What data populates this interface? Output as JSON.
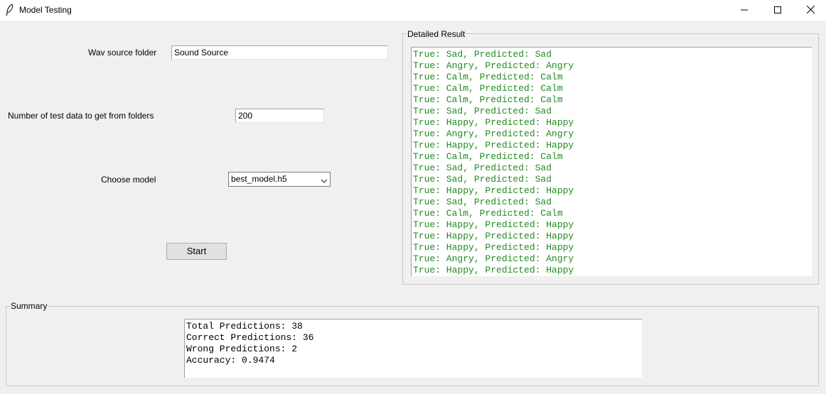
{
  "window": {
    "title": "Model Testing",
    "icon": "feather-icon",
    "controls": [
      "minimize-icon",
      "maximize-icon",
      "close-icon"
    ]
  },
  "form": {
    "wav_label": "Wav source folder",
    "wav_value": "Sound Source",
    "count_label": "Number of test data to get from folders",
    "count_value": "200",
    "model_label": "Choose model",
    "model_value": "best_model.h5",
    "start_label": "Start"
  },
  "detailed": {
    "title": "Detailed Result",
    "text_color": "#228b22",
    "lines": [
      "True: Sad, Predicted: Sad",
      "True: Angry, Predicted: Angry",
      "True: Calm, Predicted: Calm",
      "True: Calm, Predicted: Calm",
      "True: Calm, Predicted: Calm",
      "True: Sad, Predicted: Sad",
      "True: Happy, Predicted: Happy",
      "True: Angry, Predicted: Angry",
      "True: Happy, Predicted: Happy",
      "True: Calm, Predicted: Calm",
      "True: Sad, Predicted: Sad",
      "True: Sad, Predicted: Sad",
      "True: Happy, Predicted: Happy",
      "True: Sad, Predicted: Sad",
      "True: Calm, Predicted: Calm",
      "True: Happy, Predicted: Happy",
      "True: Happy, Predicted: Happy",
      "True: Happy, Predicted: Happy",
      "True: Angry, Predicted: Angry",
      "True: Happy, Predicted: Happy"
    ]
  },
  "summary": {
    "title": "Summary",
    "lines": [
      "Total Predictions: 38",
      "Correct Predictions: 36",
      "Wrong Predictions: 2",
      "Accuracy: 0.9474"
    ]
  }
}
